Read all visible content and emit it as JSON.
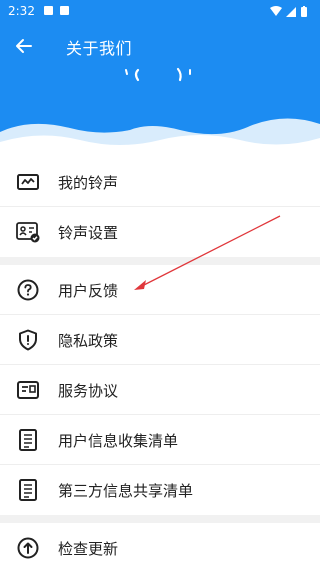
{
  "status_bar": {
    "time": "2:32"
  },
  "header": {
    "title": "关于我们",
    "logo_text": "' ( ( '"
  },
  "menu": {
    "group1": [
      {
        "label": "我的铃声",
        "icon": "chart-line-icon"
      },
      {
        "label": "铃声设置",
        "icon": "id-card-check-icon"
      }
    ],
    "group2": [
      {
        "label": "用户反馈",
        "icon": "question-circle-icon"
      },
      {
        "label": "隐私政策",
        "icon": "shield-icon"
      },
      {
        "label": "服务协议",
        "icon": "agreement-card-icon"
      },
      {
        "label": "用户信息收集清单",
        "icon": "document-list-icon"
      },
      {
        "label": "第三方信息共享清单",
        "icon": "document-list-icon"
      }
    ],
    "group3": [
      {
        "label": "检查更新",
        "icon": "upload-circle-icon"
      }
    ]
  },
  "colors": {
    "header_blue": "#1c8cf2",
    "annotation_arrow": "#e0373b"
  }
}
